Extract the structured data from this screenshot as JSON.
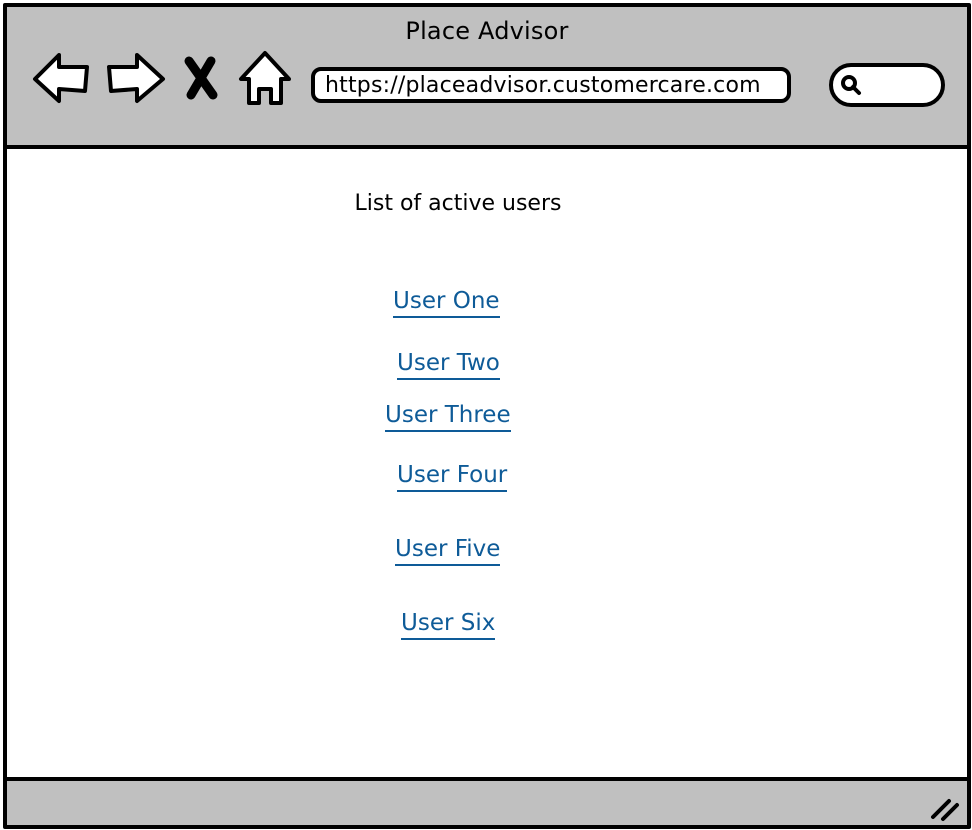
{
  "window": {
    "title": "Place Advisor"
  },
  "toolbar": {
    "icons": [
      "back-arrow-icon",
      "forward-arrow-icon",
      "close-icon",
      "home-icon"
    ],
    "url": "https://placeadvisor.customercare.com",
    "search_icon": "search-icon"
  },
  "main": {
    "heading": "List of active users",
    "users": [
      {
        "label": "User One"
      },
      {
        "label": "User Two"
      },
      {
        "label": "User Three"
      },
      {
        "label": "User Four"
      },
      {
        "label": "User Five"
      },
      {
        "label": "User Six"
      }
    ]
  },
  "colors": {
    "chrome": "#c0c0c0",
    "link": "#0e5b98",
    "border": "#000000"
  }
}
